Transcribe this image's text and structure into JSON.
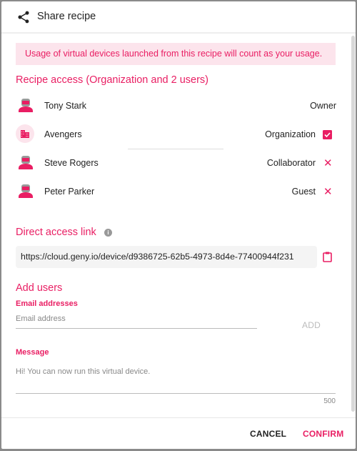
{
  "header": {
    "title": "Share recipe",
    "icon": "share-icon"
  },
  "banner": "Usage of virtual devices launched from this recipe will count as your usage.",
  "access": {
    "heading": "Recipe access (Organization and 2 users)",
    "rows": [
      {
        "name": "Tony Stark",
        "role": "Owner",
        "icon": "robot-avatar"
      },
      {
        "name": "Avengers",
        "role": "Organization",
        "icon": "building-icon",
        "checked": true
      },
      {
        "name": "Steve Rogers",
        "role": "Collaborator",
        "icon": "robot-avatar",
        "removable": true
      },
      {
        "name": "Peter Parker",
        "role": "Guest",
        "icon": "robot-avatar",
        "removable": true
      }
    ]
  },
  "link": {
    "heading": "Direct access link",
    "url": "https://cloud.geny.io/device/d9386725-62b5-4973-8d4e-77400944f231"
  },
  "add": {
    "heading": "Add users",
    "email_label": "Email addresses",
    "email_placeholder": "Email address",
    "add_label": "ADD",
    "message_label": "Message",
    "message_value": "Hi! You can now run this virtual device.",
    "counter": "500"
  },
  "footer": {
    "cancel": "CANCEL",
    "confirm": "CONFIRM"
  },
  "colors": {
    "accent": "#e91e63",
    "banner_bg": "#fce4ec"
  }
}
